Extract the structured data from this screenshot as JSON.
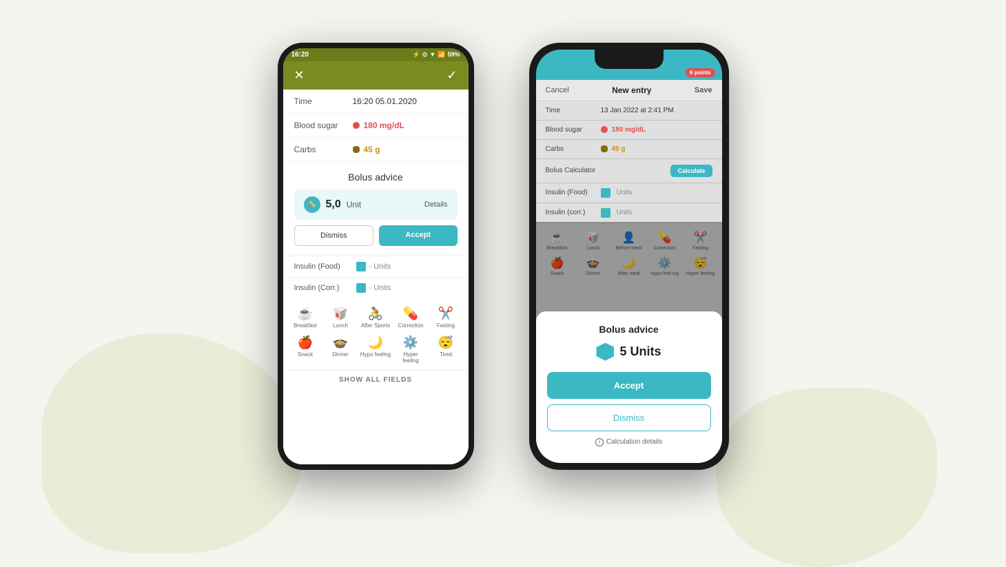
{
  "background": {
    "blob_left_color": "#e8edd8",
    "blob_right_color": "#e8edd8"
  },
  "android": {
    "status_bar": {
      "time": "16:20",
      "battery": "59%",
      "icons": "🔵⊙▼📶🔋"
    },
    "header": {
      "close_label": "✕",
      "check_label": "✓",
      "bg_color": "#7a8c1f"
    },
    "fields": {
      "time_label": "Time",
      "time_value": "16:20   05.01.2020",
      "blood_sugar_label": "Blood sugar",
      "blood_sugar_value": "180 mg/dL",
      "carbs_label": "Carbs",
      "carbs_value": "45 g"
    },
    "bolus_advice": {
      "title": "Bolus advice",
      "amount": "5,0",
      "unit": "Unit",
      "details_link": "Details",
      "dismiss_label": "Dismiss",
      "accept_label": "Accept"
    },
    "insulin": {
      "food_label": "Insulin (Food)",
      "food_value": "- Units",
      "corr_label": "Insulin (Corr.)",
      "corr_value": "- Units"
    },
    "activities": [
      {
        "label": "Breakfast",
        "icon": "☕"
      },
      {
        "label": "Lunch",
        "icon": "🥡"
      },
      {
        "label": "After Sports",
        "icon": "🚴"
      },
      {
        "label": "Correction",
        "icon": "💊"
      },
      {
        "label": "Fasting",
        "icon": "✂️"
      },
      {
        "label": "Snack",
        "icon": "🍎"
      },
      {
        "label": "Dinner",
        "icon": "🍲"
      },
      {
        "label": "Hypo feeling",
        "icon": "🌙"
      },
      {
        "label": "Hyper feeling",
        "icon": "⚙️"
      },
      {
        "label": "Tired",
        "icon": "😴"
      }
    ],
    "show_all_label": "SHOW ALL FIELDS"
  },
  "ios": {
    "status_bar": {
      "points_label": "6 points"
    },
    "nav_bar": {
      "cancel_label": "Cancel",
      "title": "New entry",
      "save_label": "Save"
    },
    "fields": {
      "time_label": "Time",
      "time_value": "13 Jan 2022 at 2:41 PM",
      "blood_sugar_label": "Blood sugar",
      "blood_sugar_value": "180 mg/dL",
      "carbs_label": "Carbs",
      "carbs_value": "45 g",
      "bolus_calc_label": "Bolus Calculator",
      "calculate_label": "Calculate",
      "insulin_food_label": "Insulin (Food)",
      "insulin_food_value": "Units",
      "insulin_corr_label": "Insulin (corr.)",
      "insulin_corr_value": "Units"
    },
    "activities": [
      {
        "label": "Breakfast",
        "icon": "☕"
      },
      {
        "label": "Lunch",
        "icon": "🥡"
      },
      {
        "label": "Before meal",
        "icon": "👤"
      },
      {
        "label": "Correction",
        "icon": "💊"
      },
      {
        "label": "Fasting",
        "icon": "✂️"
      },
      {
        "label": "Snack",
        "icon": "🍎"
      },
      {
        "label": "Dinner",
        "icon": "🍲"
      },
      {
        "label": "After meal",
        "icon": "🌙"
      },
      {
        "label": "Hypo feel-ing",
        "icon": "⚙️"
      },
      {
        "label": "Hyper feeling",
        "icon": "😴"
      }
    ],
    "modal": {
      "title": "Bolus advice",
      "units_text": "5 Units",
      "accept_label": "Accept",
      "dismiss_label": "Dismiss",
      "calc_details_label": "Calculation details"
    }
  }
}
